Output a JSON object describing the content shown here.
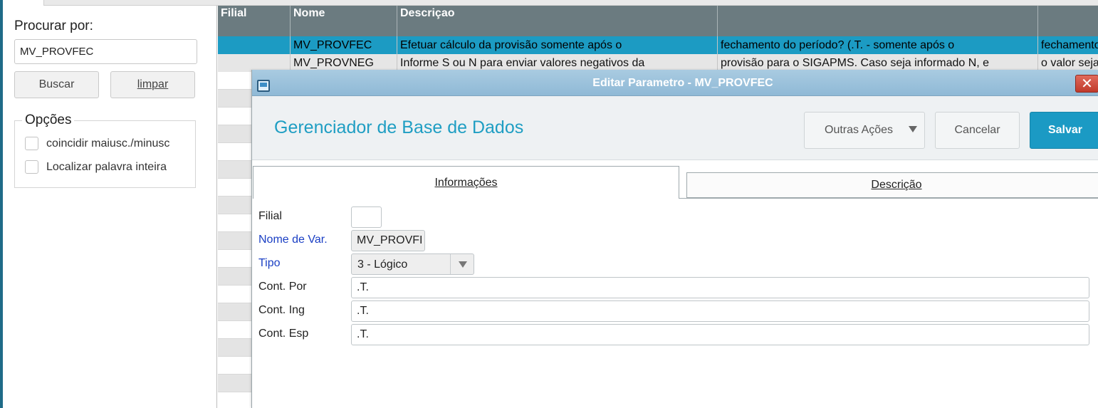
{
  "search": {
    "title": "Procurar por:",
    "value": "MV_PROVFEC",
    "buscar_label": "Buscar",
    "limpar_label": "limpar",
    "options_title": "Opções",
    "options": [
      {
        "label": "coincidir maiusc./minusc",
        "checked": false
      },
      {
        "label": "Localizar palavra inteira",
        "checked": false
      }
    ]
  },
  "grid": {
    "columns": [
      "Filial",
      "Nome",
      "Descriçao",
      "",
      ""
    ],
    "rows": [
      {
        "filial": "",
        "nome": "MV_PROVFEC",
        "descricao": "Efetuar cálculo da provisão somente após o",
        "col4": "fechamento do período? (.T. - somente após o",
        "col5": "fechamento",
        "selected": true
      },
      {
        "filial": "",
        "nome": "MV_PROVNEG",
        "descricao": "Informe S ou N para enviar valores negativos da",
        "col4": "provisão para o SIGAPMS. Caso seja informado N, e",
        "col5": "o valor seja",
        "selected": false
      }
    ]
  },
  "modal": {
    "title": "Editar Parametro - MV_PROVFEC",
    "heading": "Gerenciador de Base de Dados",
    "buttons": {
      "outras": "Outras Ações",
      "cancelar": "Cancelar",
      "salvar": "Salvar"
    },
    "tabs": [
      {
        "label": "Informações",
        "active": true
      },
      {
        "label": "Descrição",
        "active": false
      }
    ],
    "form": {
      "filial": {
        "label": "Filial",
        "value": ""
      },
      "nome": {
        "label": "Nome de Var.",
        "value": "MV_PROVFI"
      },
      "tipo": {
        "label": "Tipo",
        "value": "3 - Lógico"
      },
      "cont_por": {
        "label": "Cont. Por",
        "value": ".T."
      },
      "cont_ing": {
        "label": "Cont. Ing",
        "value": ".T."
      },
      "cont_esp": {
        "label": "Cont. Esp",
        "value": ".T."
      }
    }
  },
  "colors": {
    "accent": "#1f9ec3",
    "selected_row": "#1c9bc3",
    "header": "#6b7b80",
    "required_label": "#1a3fc4"
  }
}
